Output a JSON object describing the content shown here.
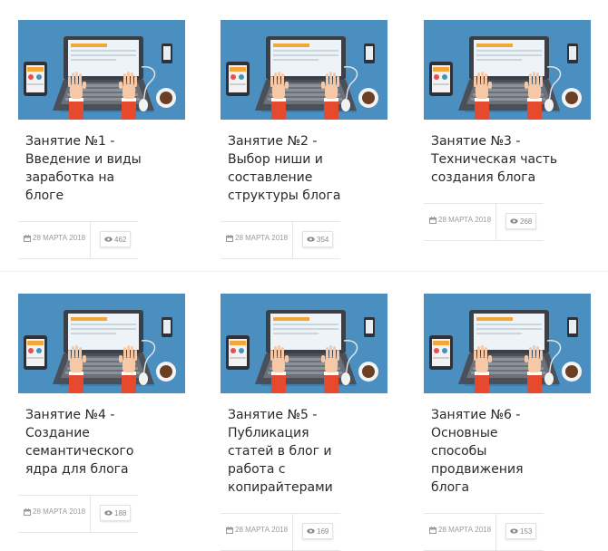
{
  "colors": {
    "thumb_bg": "#4a8fc0",
    "meta_text": "#9a9a9a",
    "title_text": "#2a2a2a"
  },
  "cards": [
    {
      "title_lines": [
        "Занятие №1 -",
        "Введение и виды",
        "заработка на",
        "блоге"
      ],
      "date": "28 МАРТА 2018",
      "views": "462"
    },
    {
      "title_lines": [
        "Занятие №2 -",
        "Выбор ниши и",
        "составление",
        "структуры блога"
      ],
      "date": "28 МАРТА 2018",
      "views": "354"
    },
    {
      "title_lines": [
        "Занятие №3 -",
        "Техническая часть",
        "создания блога"
      ],
      "date": "28 МАРТА 2018",
      "views": "268"
    },
    {
      "title_lines": [
        "Занятие №4 -",
        "Создание",
        "семантического",
        "ядра для блога"
      ],
      "date": "28 МАРТА 2018",
      "views": "188"
    },
    {
      "title_lines": [
        "Занятие №5 -",
        "Публикация",
        "статей в блог и",
        "работа с",
        "копирайтерами"
      ],
      "date": "28 МАРТА 2018",
      "views": "169"
    },
    {
      "title_lines": [
        "Занятие №6 -",
        "Основные",
        "способы",
        "продвижения",
        "блога"
      ],
      "date": "28 МАРТА 2018",
      "views": "153"
    }
  ]
}
